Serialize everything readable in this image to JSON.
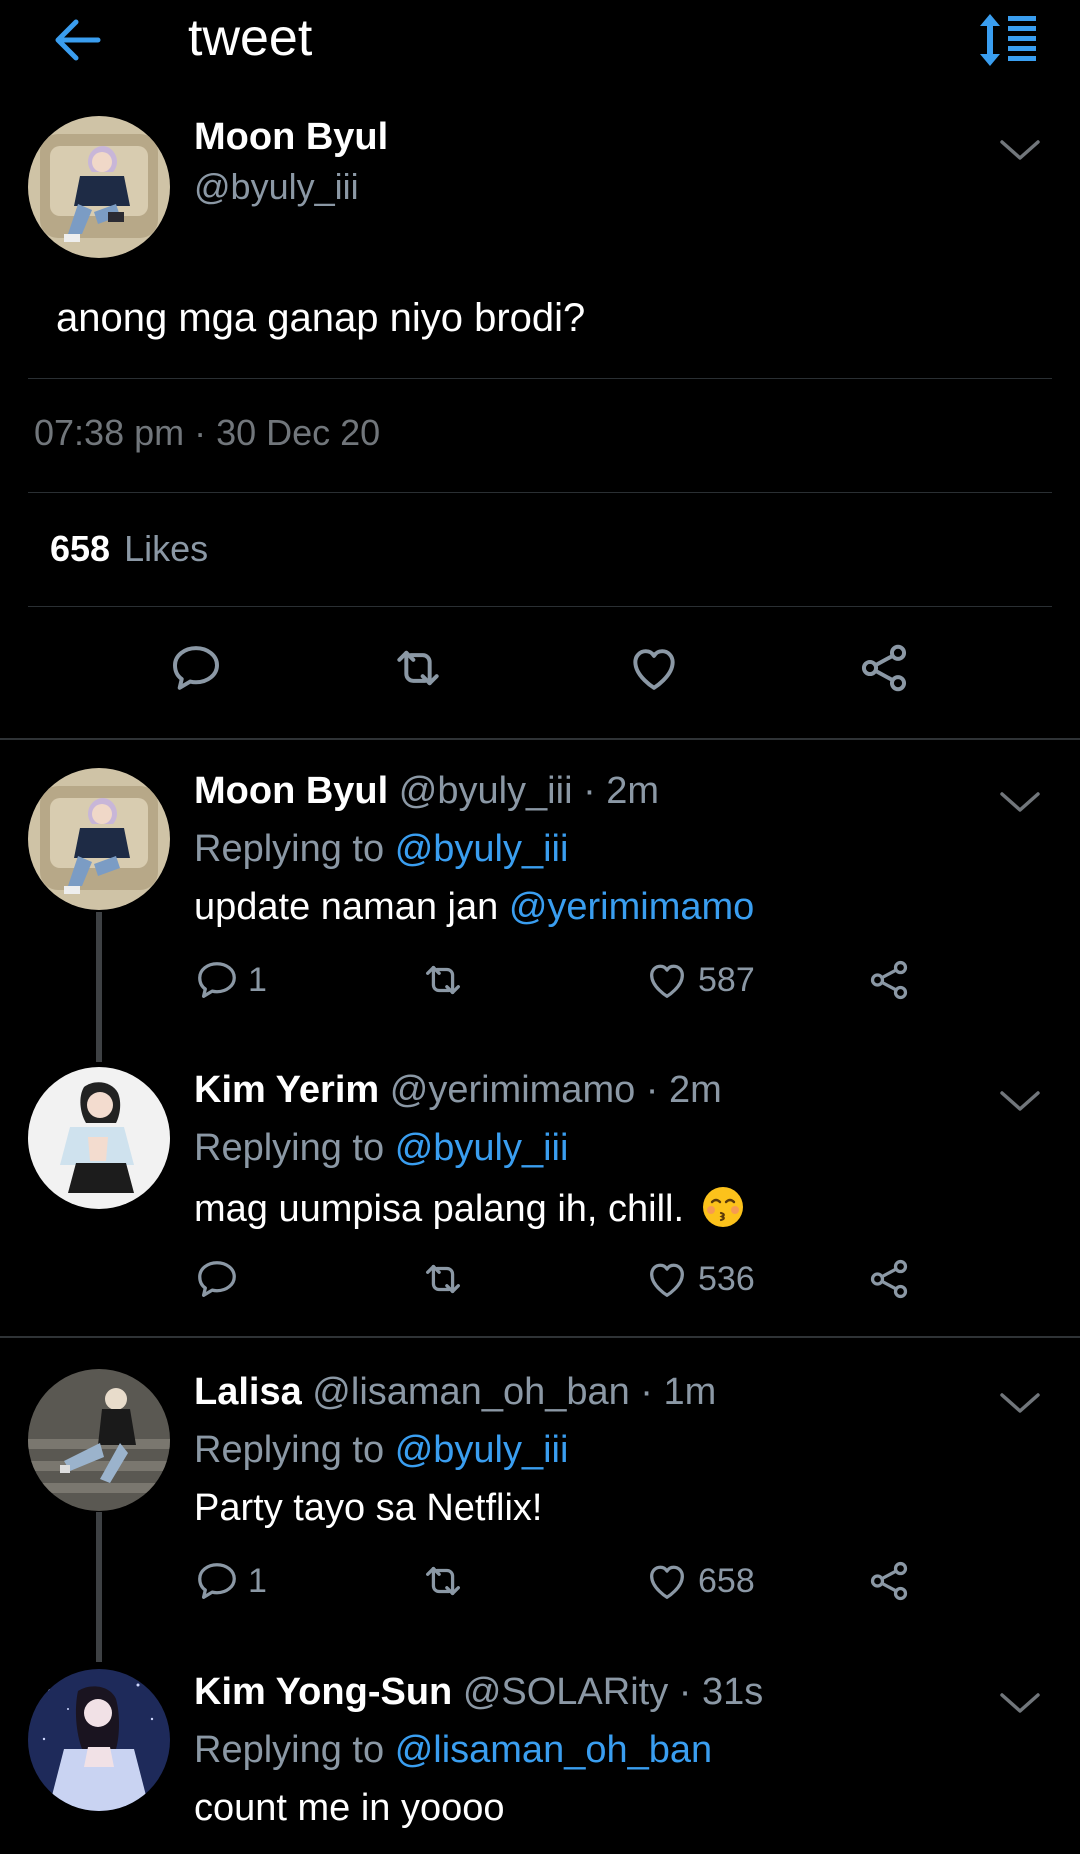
{
  "header": {
    "title": "tweet",
    "back_icon": "arrow-left-icon",
    "sort_icon": "sort-list-icon",
    "accent": "#3a9ef0"
  },
  "main_tweet": {
    "name": "Moon Byul",
    "handle": "@byuly_iii",
    "text": "anong mga ganap niyo brodi?",
    "timestamp": "07:38 pm · 30 Dec 20",
    "likes_count": "658",
    "likes_label": "Likes",
    "actions": [
      "reply-icon",
      "retweet-icon",
      "like-icon",
      "share-icon"
    ]
  },
  "replies": [
    {
      "name": "Moon Byul",
      "handle": "@byuly_iii · 2m",
      "replying_prefix": "Replying to",
      "replying_to": "@byuly_iii",
      "text": "update naman jan",
      "mention": "@yerimimamo",
      "reply_count": "1",
      "like_count": "587"
    },
    {
      "name": "Kim Yerim",
      "handle": "@yerimimamo · 2m",
      "replying_prefix": "Replying to",
      "replying_to": "@byuly_iii",
      "text": "mag uumpisa palang ih, chill.",
      "emoji": "kissing-face-emoji",
      "reply_count": "",
      "like_count": "536"
    },
    {
      "name": "Lalisa",
      "handle": "@lisaman_oh_ban · 1m",
      "replying_prefix": "Replying to",
      "replying_to": "@byuly_iii",
      "text": "Party tayo sa Netflix!",
      "reply_count": "1",
      "like_count": "658"
    },
    {
      "name": "Kim Yong-Sun",
      "handle": "@SOLARity · 31s",
      "replying_prefix": "Replying to",
      "replying_to": "@lisaman_oh_ban",
      "text": "count me in yoooo"
    }
  ]
}
